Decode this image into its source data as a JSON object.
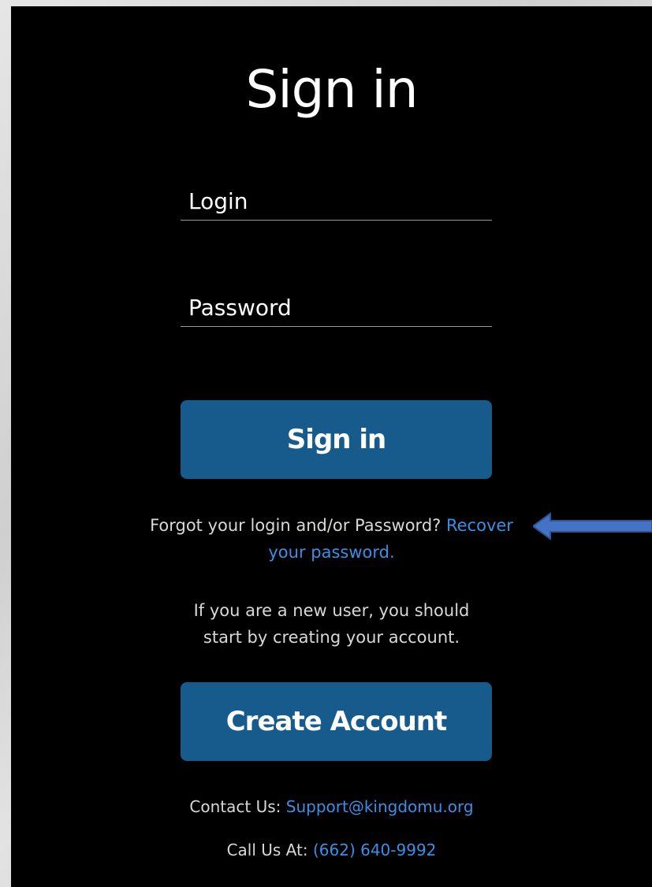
{
  "title": "Sign in",
  "login": {
    "placeholder": "Login"
  },
  "password": {
    "placeholder": "Password"
  },
  "signin_button": "Sign in",
  "forgot": {
    "text": "Forgot your login and/or Password?",
    "link": "Recover your password."
  },
  "newuser": {
    "text": "If you are a new user, you should start by creating your account."
  },
  "create_button": "Create Account",
  "contact": {
    "label": "Contact Us:",
    "email": "Support@kingdomu.org"
  },
  "call": {
    "label": "Call Us At:",
    "phone": "(662) 640-9992"
  },
  "colors": {
    "panel_bg": "#000000",
    "button_bg": "#175a8c",
    "link": "#3a8fe6",
    "arrow": "#4472c4"
  },
  "annotation": {
    "icon": "left-arrow-icon"
  }
}
